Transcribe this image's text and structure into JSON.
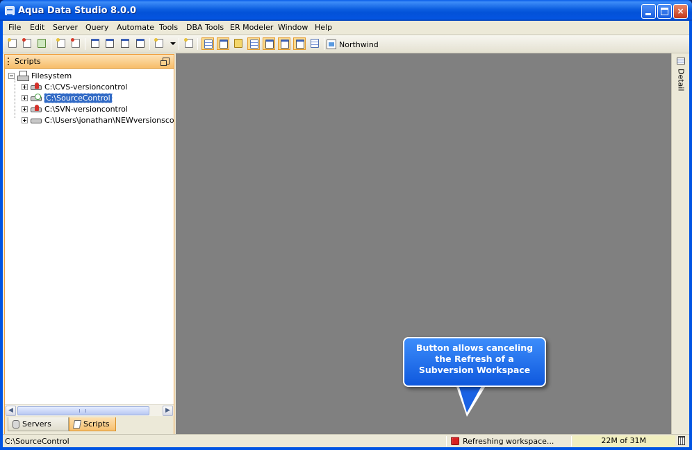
{
  "window": {
    "title": "Aqua Data Studio 8.0.0",
    "minimize": "minimize",
    "maximize": "maximize",
    "close": "×"
  },
  "menu": [
    "File",
    "Edit",
    "Server",
    "Query",
    "Automate",
    "Tools",
    "DBA Tools",
    "ER Modeler",
    "Window",
    "Help"
  ],
  "toolbar": {
    "server_label": "Northwind"
  },
  "scripts_panel": {
    "title": "Scripts",
    "tree": {
      "root": "Filesystem",
      "items": [
        {
          "label": "C:\\CVS-versioncontrol",
          "status": "red"
        },
        {
          "label": "C:\\SourceControl",
          "status": "green",
          "selected": true
        },
        {
          "label": "C:\\SVN-versioncontrol",
          "status": "red"
        },
        {
          "label": "C:\\Users\\jonathan\\NEWversionscontr",
          "status": "none"
        }
      ]
    },
    "tabs": [
      "Servers",
      "Scripts"
    ],
    "active_tab": "Scripts"
  },
  "right_dock": {
    "label": "Detail"
  },
  "callout": {
    "lines": [
      "Button allows canceling",
      "the Refresh of a",
      "Subversion Workspace"
    ]
  },
  "status": {
    "path": "C:\\SourceControl",
    "activity": "Refreshing workspace...",
    "memory": "22M of 31M"
  },
  "colors": {
    "title_bar": "#0054e3",
    "panel_header": "#f7bd6a",
    "selection": "#316ac5",
    "workspace": "#808080",
    "callout": "#1a62e4",
    "cancel_button": "#d92020"
  }
}
